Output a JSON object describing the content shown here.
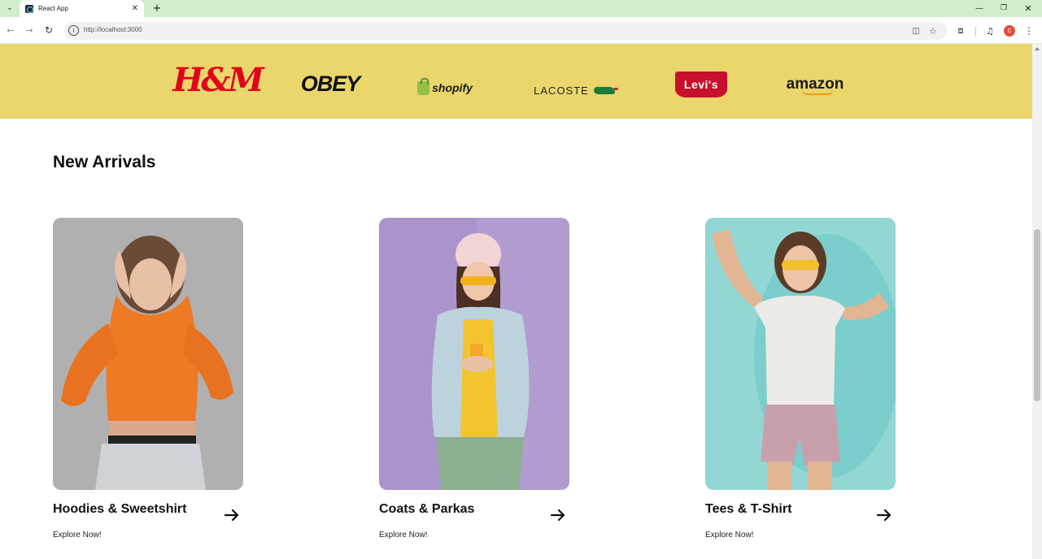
{
  "browser": {
    "tab_title": "React App",
    "tab_close_icon": "close-icon",
    "new_tab_icon": "plus-icon",
    "url": "http://localhost:3000",
    "profile_initial": "C",
    "window_controls": [
      "minimize-icon",
      "restore-icon",
      "close-icon"
    ]
  },
  "brands": {
    "background": "#ead66c",
    "items": [
      {
        "name": "H&M",
        "color": "#e3001b"
      },
      {
        "name": "OBEY",
        "color": "#111111"
      },
      {
        "name": "shopify",
        "color": "#1a1a1a"
      },
      {
        "name": "LACOSTE",
        "color": "#222222"
      },
      {
        "name": "Levi's",
        "color": "#c8102e"
      },
      {
        "name": "amazon",
        "color": "#1a1a1a"
      }
    ]
  },
  "new_arrivals": {
    "title": "New Arrivals",
    "cards": [
      {
        "title": "Hoodies & Sweetshirt",
        "link": "Explore Now!",
        "arrow_icon": "arrow-right-icon",
        "background": "#a8a8a8"
      },
      {
        "title": "Coats & Parkas",
        "link": "Explore Now!",
        "arrow_icon": "arrow-right-icon",
        "background": "#a98fc7"
      },
      {
        "title": "Tees & T-Shirt",
        "link": "Explore Now!",
        "arrow_icon": "arrow-right-icon",
        "background": "#8fd3d0"
      }
    ]
  }
}
